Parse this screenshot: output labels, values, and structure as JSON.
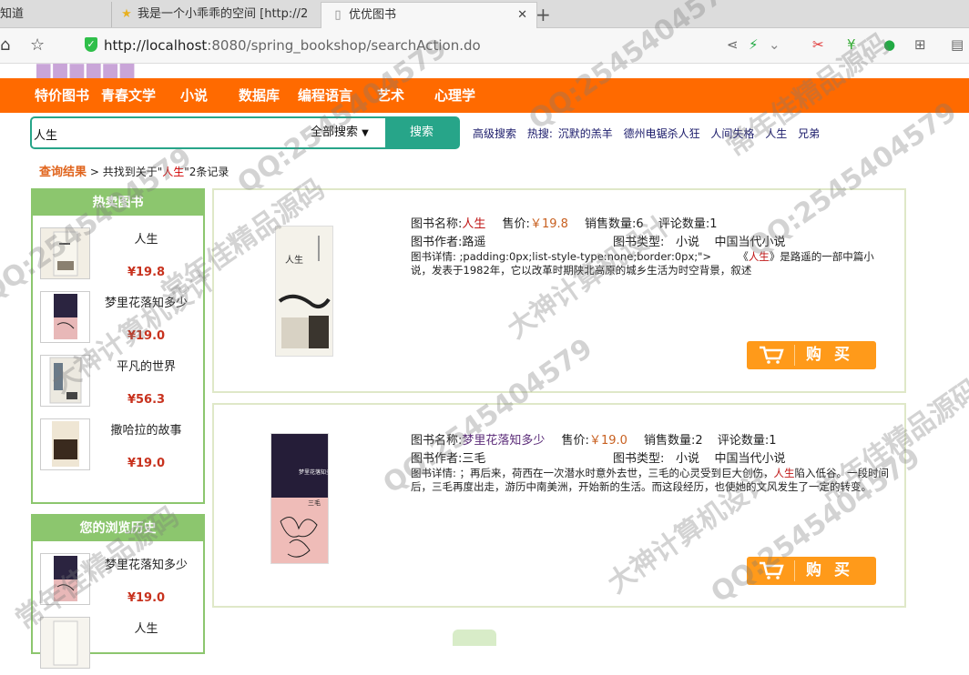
{
  "browser": {
    "tabs": [
      {
        "label": "知道"
      },
      {
        "label": "我是一个小乖乖的空间 [http://2"
      },
      {
        "label": "优优图书",
        "active": true
      }
    ],
    "url_host": "http://localhost",
    "url_rest": ":8080/spring_bookshop/searchAction.do"
  },
  "site": {
    "categories": [
      "特价图书",
      "青春文学",
      "小说",
      "数据库",
      "编程语言",
      "艺术",
      "心理学"
    ],
    "search": {
      "value": "人生",
      "scope": "全部搜索",
      "button": "搜索"
    },
    "advanced_search": "高级搜索",
    "hot_label": "热搜:",
    "hot_terms": [
      "沉默的羔羊",
      "德州电锯杀人狂",
      "人间失格",
      "人生",
      "兄弟"
    ]
  },
  "breadcrumb": {
    "title": "查询结果",
    "sep": ">",
    "prefix": "共找到关于\"",
    "keyword": "人生",
    "suffix": "\"2条记录"
  },
  "sidebar": {
    "hot_title": "热卖图书",
    "hot_items": [
      {
        "name": "人生",
        "price": "¥19.8"
      },
      {
        "name": "梦里花落知多少",
        "price": "¥19.0"
      },
      {
        "name": "平凡的世界",
        "price": "¥56.3"
      },
      {
        "name": "撒哈拉的故事",
        "price": "¥19.0"
      }
    ],
    "history_title": "您的浏览历史",
    "history_items": [
      {
        "name": "梦里花落知多少",
        "price": "¥19.0"
      },
      {
        "name": "人生",
        "price": ""
      }
    ]
  },
  "labels": {
    "name": "图书名称:",
    "price": "售价:",
    "sales": "销售数量:",
    "comments": "评论数量:",
    "author": "图书作者:",
    "type": "图书类型:",
    "detail": "图书详情:",
    "buy": "购买"
  },
  "results": [
    {
      "name": "人生",
      "price": "￥19.8",
      "sales": "6",
      "comments": "1",
      "author": "路遥",
      "type": "小说    中国当代小说",
      "detail_a": " ;padding:0px;list-style-type:none;border:0px;\">        《",
      "detail_kw": "人生",
      "detail_b": "》是路遥的一部中篇小说，发表于1982年，它以改革时期陕北高原的城乡生活为时空背景，叙述",
      "cover_title": "人生"
    },
    {
      "name": "梦里花落知多少",
      "price": "￥19.0",
      "sales": "2",
      "comments": "1",
      "author": "三毛",
      "type": "小说    中国当代小说",
      "detail_a": " ；再后来，荷西在一次潜水时意外去世，三毛的心灵受到巨大创伤，",
      "detail_kw": "人生",
      "detail_b": "陷入低谷。一段时间后，三毛再度出走，游历中南美洲，开始新的生活。而这段经历，也使她的文风发生了一定的转变。",
      "cover_title": "梦里花落知多少",
      "cover_sub": "三毛"
    }
  ],
  "watermarks": [
    "QQ:2545404579",
    "大神计算机设计",
    "常年佳精品源码"
  ],
  "colors": {
    "nav_orange": "#ff6a00",
    "accent_green": "#27a589",
    "panel_green": "#8cc66e",
    "buy_orange": "#ff9a1a",
    "price_red": "#c8321e"
  }
}
